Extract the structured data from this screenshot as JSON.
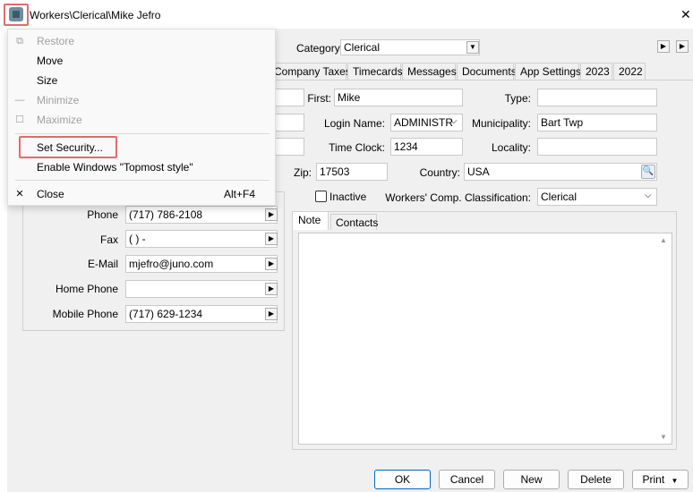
{
  "window": {
    "title": "Workers\\Clerical\\Mike Jefro",
    "close_glyph": "✕"
  },
  "header": {
    "category_label": "Category:",
    "category_value": "Clerical"
  },
  "tabs": [
    "Company Taxes",
    "Timecards",
    "Messages",
    "Documents",
    "App Settings",
    "2023",
    "2022"
  ],
  "form": {
    "first_label": "First:",
    "first_value": "Mike",
    "type_label": "Type:",
    "type_value": "",
    "login_label": "Login Name:",
    "login_value": "ADMINISTR",
    "municipality_label": "Municipality:",
    "municipality_value": "Bart Twp",
    "timeclock_label": "Time Clock:",
    "timeclock_value": "1234",
    "locality_label": "Locality:",
    "locality_value": "",
    "zip_label": "Zip:",
    "zip_value": "17503",
    "country_label": "Country:",
    "country_value": "USA",
    "inactive_label": "Inactive",
    "comp_label": "Workers' Comp. Classification:",
    "comp_value": "Clerical"
  },
  "contact": {
    "phone_label": "Phone",
    "phone_value": "(717) 786-2108",
    "fax_label": "Fax",
    "fax_value": "(   )    -",
    "email_label": "E-Mail",
    "email_value": "mjefro@juno.com",
    "homephone_label": "Home Phone",
    "homephone_value": "",
    "mobile_label": "Mobile Phone",
    "mobile_value": "(717) 629-1234"
  },
  "notes": {
    "tab_note": "Note",
    "tab_contacts": "Contacts"
  },
  "buttons": {
    "ok": "OK",
    "cancel": "Cancel",
    "new": "New",
    "delete": "Delete",
    "print": "Print"
  },
  "system_menu": {
    "restore": "Restore",
    "move": "Move",
    "size": "Size",
    "minimize": "Minimize",
    "maximize": "Maximize",
    "set_security": "Set Security...",
    "topmost": "Enable Windows \"Topmost style\"",
    "close": "Close",
    "close_shortcut": "Alt+F4"
  }
}
